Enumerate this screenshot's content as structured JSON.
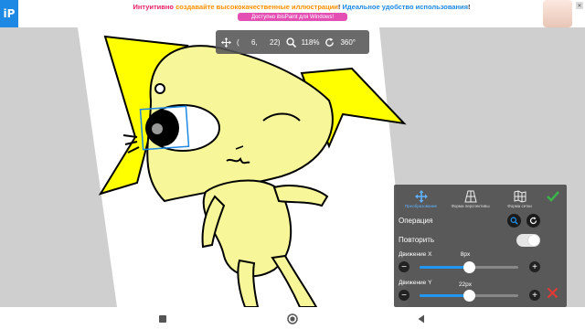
{
  "ad": {
    "logo_text": "iP",
    "headline_part1": "Интуитивно ",
    "headline_part2": "создавайте высококачественные иллюстрации",
    "headline_part3": "! ",
    "headline_part4": "Идеальное удобство использования",
    "headline_part5": "!",
    "button_label": "Доступно ibisPaint для Windows!",
    "close_label": "✕"
  },
  "toolbar": {
    "coords": "(      6,      22)",
    "zoom": "118%",
    "rotation": "360°"
  },
  "panel": {
    "modes": [
      {
        "label": "Преобразование",
        "icon": "move-arrows-icon",
        "active": true
      },
      {
        "label": "Форма перспективы",
        "icon": "perspective-grid-icon",
        "active": false
      },
      {
        "label": "Форма сетки",
        "icon": "mesh-map-icon",
        "active": false
      }
    ],
    "operation_label": "Операция",
    "repeat_label": "Повторить",
    "repeat_on": true,
    "move_x": {
      "label": "Движение X",
      "value_text": "8px",
      "level": 0.5
    },
    "move_y": {
      "label": "Движение Y",
      "value_text": "22px",
      "level": 0.5
    },
    "confirm_icon": "checkmark-icon",
    "cancel_icon": "close-icon",
    "accent_color": "#2196f3",
    "confirm_color": "#3cb34a",
    "cancel_color": "#e53935"
  },
  "nav": {
    "icons": [
      "square-stop-icon",
      "record-circle-icon",
      "back-triangle-icon"
    ]
  }
}
